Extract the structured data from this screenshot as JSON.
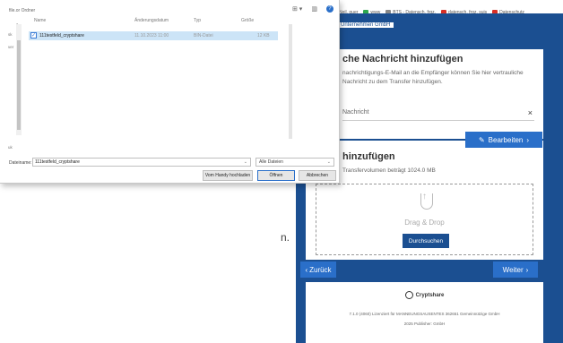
{
  "browser": {
    "bookmarks": [
      {
        "label": "Neil, guer",
        "color": "#3c8dd9"
      },
      {
        "label": "www",
        "color": "#2fa84f"
      },
      {
        "label": "BTS - Datensch. frgz.",
        "color": "#888888"
      },
      {
        "label": "datensch. frgz. suis",
        "color": "#d93025"
      },
      {
        "label": "Datenschutz",
        "color": "#d93025"
      }
    ]
  },
  "app": {
    "header": "Unternehmen GmbH",
    "message_section": {
      "title": "che Nachricht hinzufügen",
      "description": "nachrichtigungs-E-Mail an die Empfänger können Sie hier vertrauliche Nachricht zu dem Transfer hinzufügen.",
      "field_value": "Nachricht",
      "clear_icon": "×",
      "edit_button": "Bearbeiten"
    },
    "file_section": {
      "title": "hinzufügen",
      "quota_text": "Transfervolumen beträgt 1024.0 MB",
      "dropzone_label": "Drag & Drop",
      "browse_button": "Durchsuchen"
    },
    "back_button": "Zurück",
    "next_button": "Weiter",
    "footer": {
      "logo_text": "Cryptshare",
      "line1": "7.1.0 (4060) Lizenziert für MANNEUNGSAUSENTES 362651 Gemeinnützige GmbH",
      "line2": "2025 Publisher: GmbH"
    },
    "stray_text": "n."
  },
  "dialog": {
    "breadcrumb": "file.or Ordner",
    "nav_labels": [
      "uk",
      "ver",
      "sk"
    ],
    "columns": {
      "name": "Name",
      "date": "Änderungsdatum",
      "type": "Typ",
      "size": "Größe"
    },
    "files": [
      {
        "name": "111testfeld_cryptshare",
        "date": "11.10.2023 11:00",
        "type": "BIN-Datei",
        "size": "12 KB",
        "checked": true
      }
    ],
    "filename_label": "Dateiname:",
    "filename_value": "111testfeld_cryptshare",
    "filter_value": "Alle Dateien",
    "device_button": "Vom Handy hochladen",
    "open_button": "Öffnen",
    "cancel_button": "Abbrechen",
    "view_icon": "⊞ ▾",
    "pane_icon": "▥",
    "help_icon": "?"
  }
}
